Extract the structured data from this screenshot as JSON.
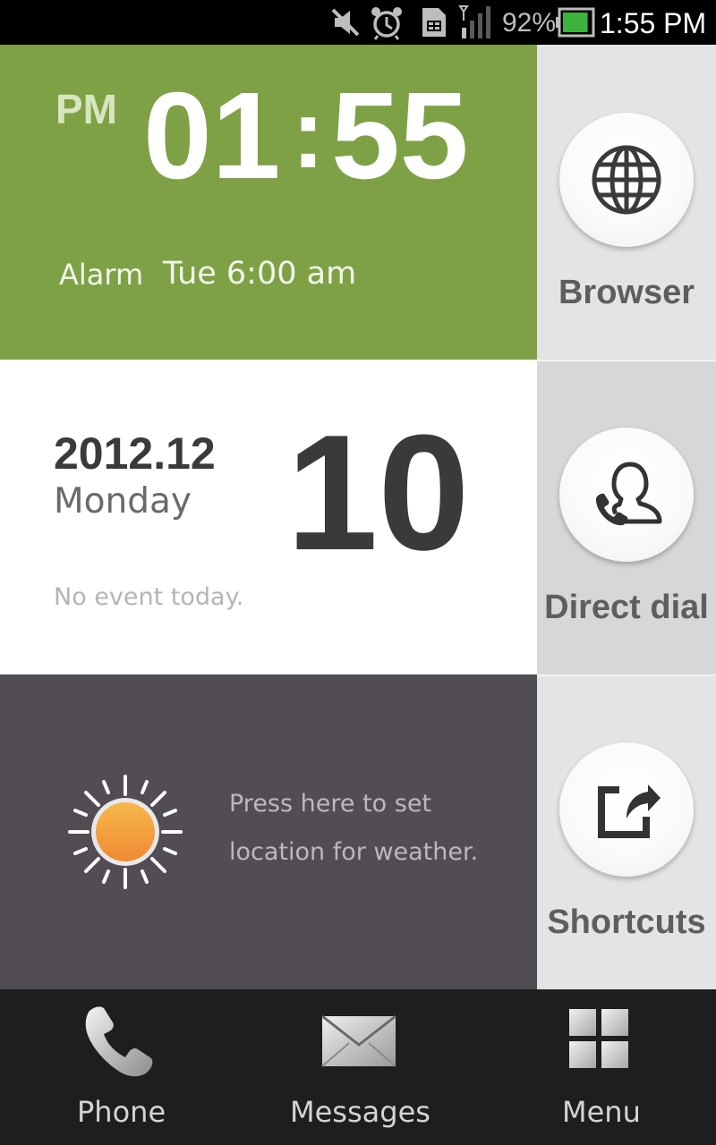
{
  "status_bar": {
    "battery_percent": "92%",
    "time": "1:55 PM",
    "icons": [
      "mute-icon",
      "alarm-icon",
      "sim-icon",
      "signal-icon",
      "battery-icon"
    ],
    "battery_level": 0.92
  },
  "clock": {
    "ampm": "PM",
    "hours": "01",
    "separator": ":",
    "minutes": "55",
    "alarm_label": "Alarm",
    "alarm_time": "Tue 6:00 am"
  },
  "date": {
    "year_month": "2012.12",
    "weekday": "Monday",
    "day": "10",
    "events": "No event today."
  },
  "weather": {
    "message_line1": "Press here to set",
    "message_line2": "location for weather.",
    "icon": "sun-icon"
  },
  "side": {
    "browser_label": "Browser",
    "dial_label": "Direct dial",
    "shortcuts_label": "Shortcuts"
  },
  "dock": {
    "phone_label": "Phone",
    "messages_label": "Messages",
    "menu_label": "Menu"
  },
  "colors": {
    "clock_bg": "#7ea146",
    "weather_bg": "#524c55",
    "dock_bg": "#1e1e1e"
  }
}
